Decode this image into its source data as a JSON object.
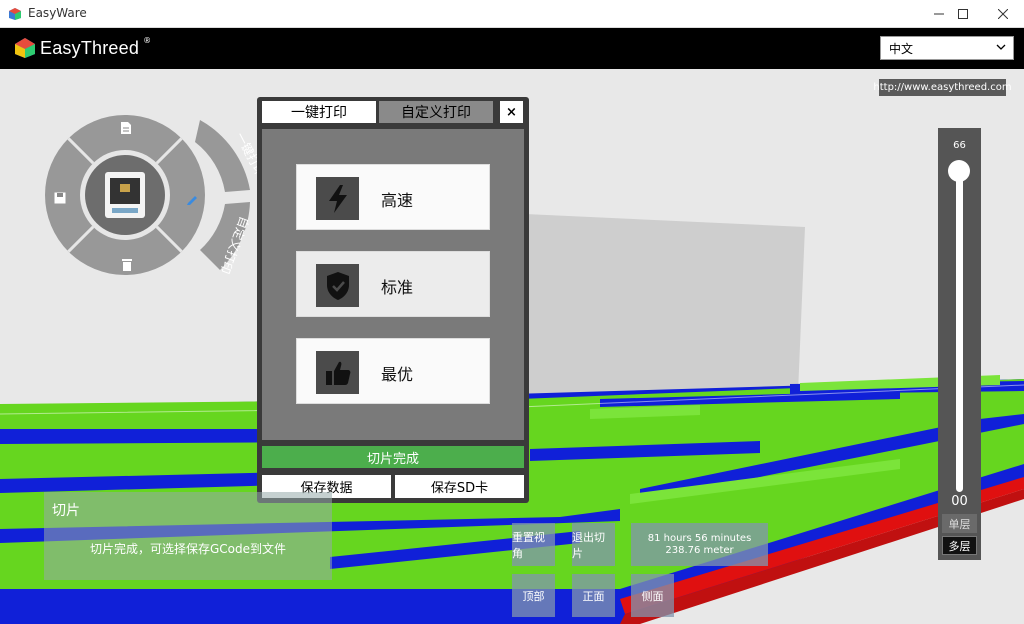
{
  "window": {
    "title": "EasyWare"
  },
  "header": {
    "logo_text": "EasyThreed",
    "logo_reg": "®",
    "language": "中文"
  },
  "website": "http://www.easythreed.com",
  "wheel": {
    "one_click_print": "一键打印",
    "custom_print": "自定义打印"
  },
  "dialog": {
    "tab_one_click": "一键打印",
    "tab_custom": "自定义打印",
    "close": "×",
    "modes": [
      {
        "label": "高速",
        "icon": "lightning-icon"
      },
      {
        "label": "标准",
        "icon": "shield-check-icon"
      },
      {
        "label": "最优",
        "icon": "thumbs-up-icon"
      }
    ],
    "slice_status": "切片完成",
    "save_data": "保存数据",
    "save_sd": "保存SD卡"
  },
  "layer_slider": {
    "top_value": "66",
    "bottom_value": "00",
    "single_layer": "单层",
    "multi_layer": "多层"
  },
  "info_panel": {
    "title": "切片",
    "message": "切片完成，可选择保存GCode到文件"
  },
  "view_buttons": {
    "reset_view": "重置视角",
    "exit_slice": "退出切片",
    "top": "顶部",
    "front": "正面",
    "side": "侧面"
  },
  "print_stats": {
    "time": "81 hours 56 minutes",
    "length": "238.76 meter"
  },
  "colors": {
    "accent_green": "#4cae4c",
    "model_green": "#66d61f",
    "model_blue": "#0a1ed8",
    "model_red": "#e01010"
  }
}
